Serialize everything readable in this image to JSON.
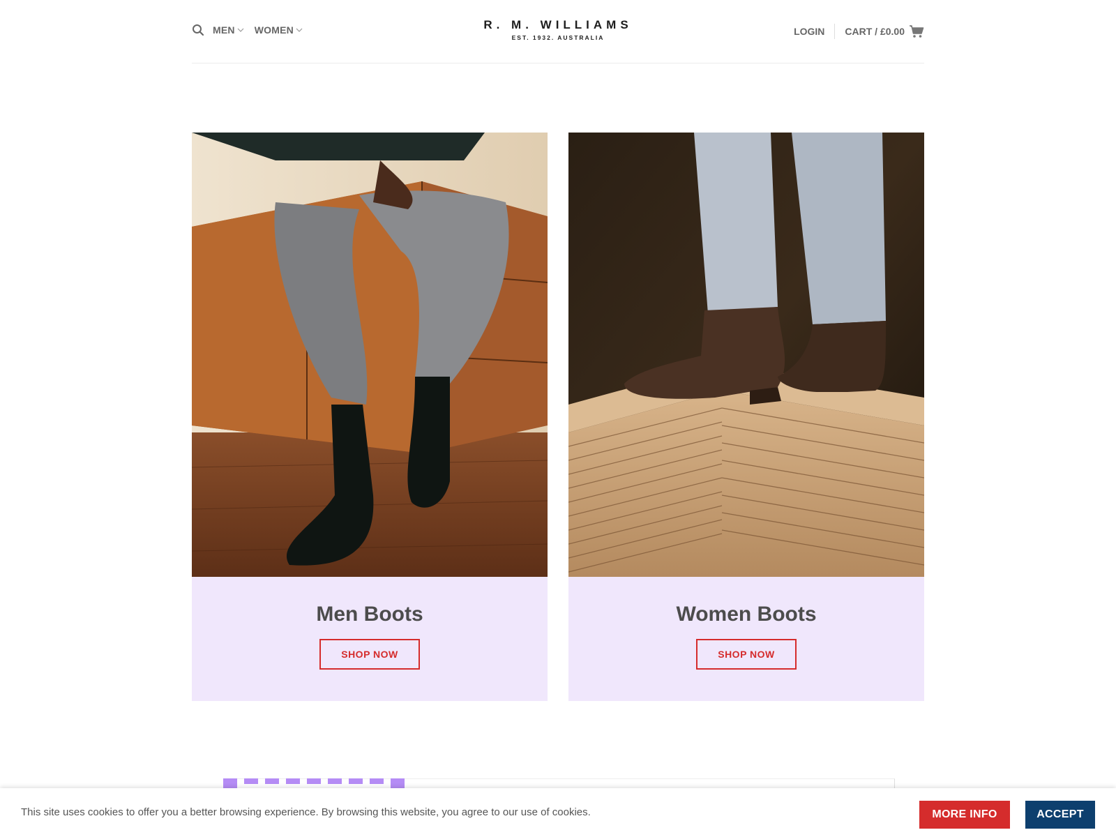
{
  "header": {
    "search_icon": "search-icon",
    "nav": [
      {
        "label": "MEN"
      },
      {
        "label": "WOMEN"
      }
    ],
    "logo": {
      "main": "R. M. WILLIAMS",
      "sub": "EST. 1932. AUSTRALIA"
    },
    "login_label": "LOGIN",
    "cart_label": "CART / £0.00",
    "cart_icon": "cart-icon"
  },
  "cards": [
    {
      "title": "Men Boots",
      "button": "SHOP NOW",
      "image": "man seated on wooden sideboard wearing grey trousers and black chelsea boots"
    },
    {
      "title": "Women Boots",
      "button": "SHOP NOW",
      "image": "woman in light jeans wearing brown suede heeled boots standing on cardboard stack"
    }
  ],
  "cookie": {
    "text": "This site uses cookies to offer you a better browsing experience. By browsing this website, you agree to our use of cookies.",
    "more_info": "MORE INFO",
    "accept": "ACCEPT"
  },
  "colors": {
    "accent_red": "#d52c2c",
    "accept_blue": "#0d3f6e",
    "card_bg": "#f0e7fc",
    "promo_dash": "#b58cf5"
  }
}
